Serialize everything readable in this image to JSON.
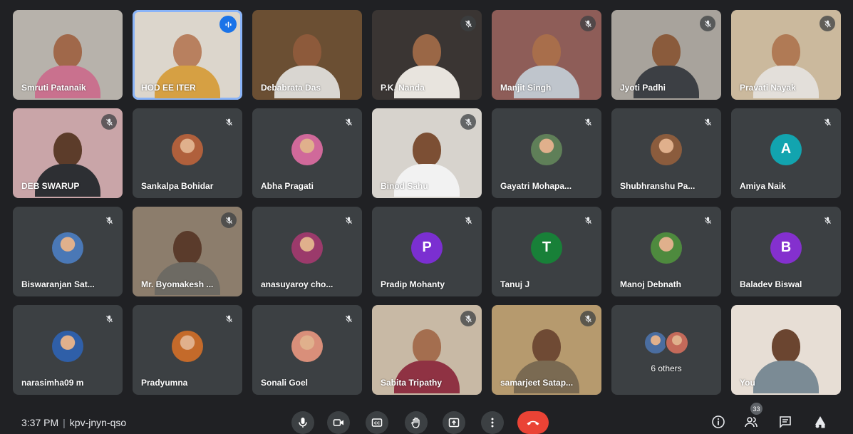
{
  "participants": [
    {
      "name": "Smruti Patanaik",
      "kind": "video",
      "bg": "#b7b2ab",
      "skin": "#a0684a",
      "shirt": "#c9718e"
    },
    {
      "name": "HOD EE ITER",
      "kind": "video",
      "bg": "#dcd6cc",
      "skin": "#b8805f",
      "shirt": "#d6a043",
      "speaking": true
    },
    {
      "name": "Debabrata Das",
      "kind": "video",
      "bg": "#6b4f33",
      "skin": "#8d5a3b",
      "shirt": "#d9d6d1"
    },
    {
      "name": "P.K. Nanda",
      "kind": "video",
      "bg": "#3a3533",
      "skin": "#9a6746",
      "shirt": "#e8e4de",
      "muted": true
    },
    {
      "name": "Manjit Singh",
      "kind": "video",
      "bg": "#8e5d58",
      "skin": "#a86e4b",
      "shirt": "#bfc5cc",
      "muted": true
    },
    {
      "name": "Jyoti Padhi",
      "kind": "video",
      "bg": "#a8a39c",
      "skin": "#8a5b3c",
      "shirt": "#3c3f44",
      "muted": true
    },
    {
      "name": "Pravati Nayak",
      "kind": "video",
      "bg": "#cbb99d",
      "skin": "#b07a55",
      "shirt": "#e3dfda",
      "muted": true
    },
    {
      "name": "DEB SWARUP",
      "kind": "video",
      "bg": "#c9a5a8",
      "skin": "#5c3c2a",
      "shirt": "#2d2f33",
      "muted": true
    },
    {
      "name": "Sankalpa Bohidar",
      "kind": "photo",
      "color": "#b0603c",
      "muted": true
    },
    {
      "name": "Abha Pragati",
      "kind": "photo",
      "color": "#d0699a",
      "muted": true
    },
    {
      "name": "Binod Sahu",
      "kind": "video",
      "bg": "#d7d3cd",
      "skin": "#7c4f34",
      "shirt": "#f2f2f2",
      "muted": true
    },
    {
      "name": "Gayatri Mohapa...",
      "kind": "photo",
      "color": "#5f7f58",
      "muted": true
    },
    {
      "name": "Shubhranshu Pa...",
      "kind": "photo",
      "color": "#8b5c3d",
      "muted": true
    },
    {
      "name": "Amiya Naik",
      "kind": "letter",
      "letter": "A",
      "color": "#12a4af",
      "muted": true
    },
    {
      "name": "Biswaranjan Sat...",
      "kind": "photo",
      "color": "#4a78b6",
      "muted": true
    },
    {
      "name": "Mr. Byomakesh ...",
      "kind": "video",
      "bg": "#8c7d6c",
      "skin": "#5a3b2b",
      "shirt": "#6d6a63",
      "muted": true
    },
    {
      "name": "anasuyaroy cho...",
      "kind": "photo",
      "color": "#9b3a6b",
      "muted": true
    },
    {
      "name": "Pradip Mohanty",
      "kind": "letter",
      "letter": "P",
      "color": "#7b2fd1",
      "muted": true
    },
    {
      "name": "Tanuj J",
      "kind": "letter",
      "letter": "T",
      "color": "#188038",
      "muted": true
    },
    {
      "name": "Manoj Debnath",
      "kind": "photo",
      "color": "#4e8a3e",
      "muted": true
    },
    {
      "name": "Baladev Biswal",
      "kind": "letter",
      "letter": "B",
      "color": "#8430ce",
      "muted": true
    },
    {
      "name": "narasimha09 m",
      "kind": "photo",
      "color": "#2f5fa8",
      "muted": true
    },
    {
      "name": "Pradyumna",
      "kind": "photo",
      "color": "#c46a2a",
      "muted": true
    },
    {
      "name": "Sonali Goel",
      "kind": "photo",
      "color": "#d98f7a",
      "muted": true
    },
    {
      "name": "Sabita Tripathy",
      "kind": "video",
      "bg": "#c8b9a5",
      "skin": "#a46e4f",
      "shirt": "#8f3243",
      "muted": true
    },
    {
      "name": "samarjeet Satap...",
      "kind": "video",
      "bg": "#b69a6e",
      "skin": "#6f4a34",
      "shirt": "#7a6a52",
      "muted": true
    },
    {
      "name": "6 others",
      "kind": "others"
    },
    {
      "name": "You",
      "kind": "video",
      "bg": "#e7ded5",
      "skin": "#6b4530",
      "shirt": "#7b8b95"
    }
  ],
  "bottom_bar": {
    "time": "3:37 PM",
    "separator": "|",
    "meeting_code": "kpv-jnyn-qso",
    "people_count": "33"
  },
  "colors": {
    "background": "#202124",
    "tile": "#3c4043",
    "end_call": "#ea4335",
    "speaking": "#1a73e8"
  }
}
